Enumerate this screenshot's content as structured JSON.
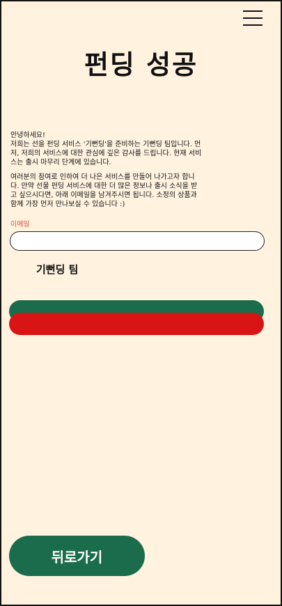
{
  "colors": {
    "background": "#fff3e0",
    "primary_green": "#1b6c4c",
    "primary_red": "#d81414",
    "label_accent": "#e04a3c",
    "text": "#111111"
  },
  "header": {
    "menu_icon": "hamburger-menu-icon"
  },
  "page": {
    "title": "펀딩 성공"
  },
  "intro": {
    "greeting": "안녕하세요!",
    "paragraph1": "저희는 선을 펀딩 서비스 '기뻔딩'을 준비하는 기뻔딩 팀입니다. 먼저, 저희의 서비스에 대한 관심에 깊은 감사를 드립니다. 현재 서비스는 출시 마무리 단계에 있습니다.",
    "paragraph2": "여러분의 참여로 인하여 더 나은 서비스를 만들어 나가고자 합니다. 만약 선물 펀딩 서비스에 대한 더 많은 정보나 출시 소식을 받고 싶으시다면, 아래 이메일을 남겨주시면 됩니다. 소정의 상품과 함께 가장 먼저 만나보실 수 있습니다 :)"
  },
  "email": {
    "label": "이메일",
    "value": "",
    "placeholder": ""
  },
  "signature": "기뻔딩 팀",
  "actions": {
    "back_label": "뒤로가기"
  }
}
